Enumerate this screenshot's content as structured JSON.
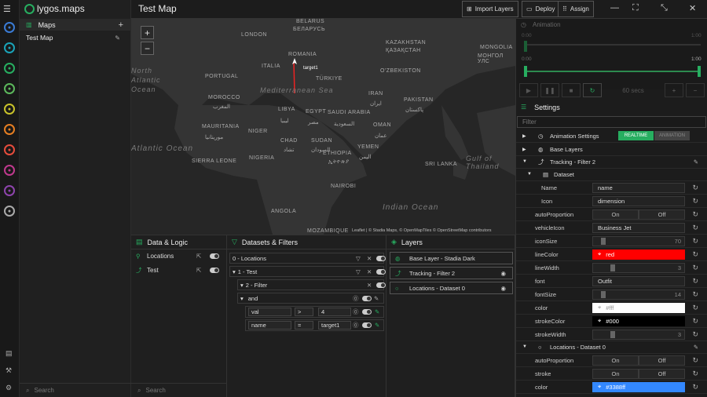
{
  "app": {
    "brand": "lygos.maps",
    "title": "Test Map"
  },
  "colors": {
    "accent": "#27ae60",
    "red": "#ff0000",
    "blue": "#3388ff"
  },
  "rail": {
    "icons": [
      "globe-icon",
      "database-icon",
      "grid-icon",
      "layers-icon",
      "cube-icon",
      "gear-icon",
      "pin-icon",
      "people-icon",
      "user-icon",
      "circle-icon"
    ],
    "bottom": [
      "log-icon",
      "tools-icon",
      "settings-icon"
    ]
  },
  "left": {
    "header": "Maps",
    "items": [
      "Test Map"
    ],
    "search": "Search"
  },
  "toolbar": {
    "import": "Import Layers",
    "deploy": "Deploy",
    "assign": "Assign"
  },
  "map": {
    "labels": [
      "LONDON",
      "BELARUS",
      "БЕЛАРУСЬ",
      "KAZAKHSTAN",
      "ҚАЗАҚСТАН",
      "MONGOLIA",
      "МОНГОЛ УЛС",
      "ROMANIA",
      "ITALIA",
      "PORTUGAL",
      "TÜRKIYE",
      "O'ZBEKISTON",
      "IRAN",
      "ایران",
      "PAKISTAN",
      "پاکستان",
      "MOROCCO",
      "المغرب",
      "LIBYA",
      "ليبيا",
      "EGYPT",
      "مصر",
      "SAUDI ARABIA",
      "السعودية",
      "OMAN",
      "عمان",
      "MAURITANIA",
      "موريتانيا",
      "NIGER",
      "CHAD",
      "تشاد",
      "SUDAN",
      "السودان",
      "YEMEN",
      "اليمن",
      "ETHIOPIA",
      "ኢትዮጵያ",
      "SIERRA LEONE",
      "NIGERIA",
      "SRI LANKA",
      "NAIROBI",
      "ANGOLA",
      "MOZAMBIQUE"
    ],
    "oceans": [
      "North Atlantic Ocean",
      "Mediterranean Sea",
      "Atlantic Ocean",
      "Indian Ocean",
      "Gulf of Thailand"
    ],
    "marker": "target1",
    "attribution": "Leaflet | © Stadia Maps, © OpenMapTiles © OpenStreetMap contributors"
  },
  "datalogic": {
    "title": "Data & Logic",
    "items": [
      "Locations",
      "Test"
    ]
  },
  "datasets": {
    "title": "Datasets & Filters",
    "rows": [
      "0 - Locations",
      "1 - Test",
      "2 - Filter",
      "and"
    ],
    "cond1": {
      "field": "val",
      "op": ">",
      "value": "4"
    },
    "cond2": {
      "field": "name",
      "op": "=",
      "value": "target1"
    }
  },
  "layers": {
    "title": "Layers",
    "items": [
      "Base Layer - Stadia Dark",
      "Tracking - Filter 2",
      "Locations - Dataset 0"
    ]
  },
  "animation": {
    "title": "Animation",
    "t0": "0:00",
    "t1": "1:00",
    "duration": "60 secs"
  },
  "settings": {
    "title": "Settings",
    "filter": "Filter",
    "anim": "Animation Settings",
    "realtime": "REALTIME",
    "animation": "ANIMATION",
    "base": "Base Layers",
    "tracking": "Tracking - Filter 2",
    "dataset": "Dataset",
    "locations": "Locations - Dataset 0",
    "rows": [
      {
        "k": "Name",
        "v": "name"
      },
      {
        "k": "Icon",
        "v": "dimension"
      },
      {
        "k": "autoProportion",
        "on": "On",
        "off": "Off"
      },
      {
        "k": "vehicleIcon",
        "v": "Business Jet"
      },
      {
        "k": "iconSize",
        "v": "70",
        "level": 0.1
      },
      {
        "k": "lineColor",
        "v": "red"
      },
      {
        "k": "lineWidth",
        "v": "3",
        "level": 0.2
      },
      {
        "k": "font",
        "v": "Outfit"
      },
      {
        "k": "fontSize",
        "v": "14",
        "level": 0.1
      },
      {
        "k": "color",
        "v": "#fff"
      },
      {
        "k": "strokeColor",
        "v": "#000"
      },
      {
        "k": "strokeWidth",
        "v": "3",
        "level": 0.2
      }
    ],
    "rows2": [
      {
        "k": "autoProportion",
        "on": "On",
        "off": "Off"
      },
      {
        "k": "stroke",
        "on": "On",
        "off": "Off"
      },
      {
        "k": "color",
        "v": "#3388ff"
      }
    ]
  }
}
